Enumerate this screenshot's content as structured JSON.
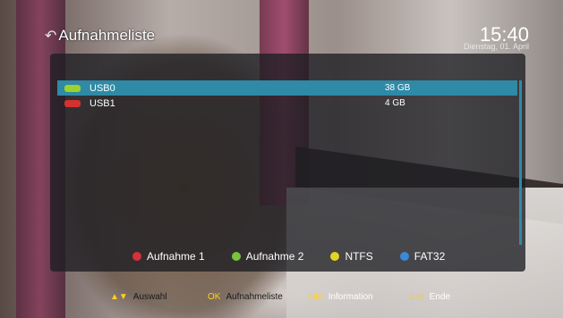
{
  "header": {
    "title": "Aufnahmeliste",
    "time": "15:40",
    "date": "Dienstag, 01. April",
    "back_icon": "back-arrow-icon"
  },
  "devices": [
    {
      "name": "USB0",
      "size": "38 GB",
      "color": "#9fd12a",
      "selected": true
    },
    {
      "name": "USB1",
      "size": "4 GB",
      "color": "#d5312e",
      "selected": false
    }
  ],
  "legend": [
    {
      "label": "Aufnahme 1",
      "color": "#d4313b"
    },
    {
      "label": "Aufnahme 2",
      "color": "#78c43a"
    },
    {
      "label": "NTFS",
      "color": "#e3d51f"
    },
    {
      "label": "FAT32",
      "color": "#3a8ad8"
    }
  ],
  "footer": {
    "arrows_key": "▲▼",
    "arrows_label": "Auswahl",
    "ok_key": "OK",
    "ok_label": "Aufnahmeliste",
    "info_key": "Info",
    "info_label": "Information",
    "exit_key": "Exit",
    "exit_label": "Ende"
  },
  "colors": {
    "selection": "#2e8aa6",
    "key_yellow": "#ffd21c"
  }
}
